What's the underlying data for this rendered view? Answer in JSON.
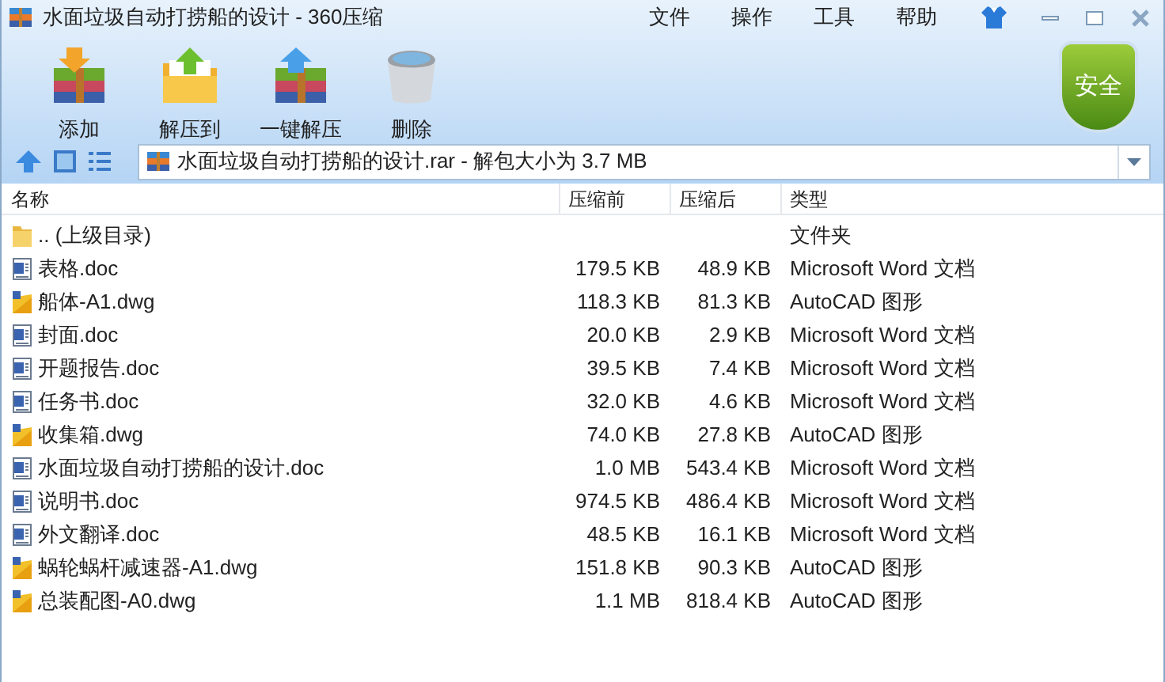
{
  "window": {
    "title": "水面垃圾自动打捞船的设计 - 360压缩"
  },
  "menu": [
    "文件",
    "操作",
    "工具",
    "帮助"
  ],
  "toolbar": [
    {
      "kind": "add",
      "label": "添加"
    },
    {
      "kind": "extract_to",
      "label": "解压到"
    },
    {
      "kind": "extract",
      "label": "一键解压"
    },
    {
      "kind": "delete",
      "label": "删除"
    }
  ],
  "security_badge": "安全",
  "address": "水面垃圾自动打捞船的设计.rar - 解包大小为 3.7 MB",
  "table": {
    "columns": [
      "名称",
      "压缩前",
      "压缩后",
      "类型"
    ],
    "rows": [
      {
        "kind": "folder",
        "name": ".. (上级目录)",
        "type": "文件夹"
      },
      {
        "kind": "doc",
        "name": "表格.doc",
        "before": "179.5 KB",
        "after": "48.9 KB",
        "type": "Microsoft Word 文档"
      },
      {
        "kind": "dwg",
        "name": "船体-A1.dwg",
        "before": "118.3 KB",
        "after": "81.3 KB",
        "type": "AutoCAD 图形"
      },
      {
        "kind": "doc",
        "name": "封面.doc",
        "before": "20.0 KB",
        "after": "2.9 KB",
        "type": "Microsoft Word 文档"
      },
      {
        "kind": "doc",
        "name": "开题报告.doc",
        "before": "39.5 KB",
        "after": "7.4 KB",
        "type": "Microsoft Word 文档"
      },
      {
        "kind": "doc",
        "name": "任务书.doc",
        "before": "32.0 KB",
        "after": "4.6 KB",
        "type": "Microsoft Word 文档"
      },
      {
        "kind": "dwg",
        "name": "收集箱.dwg",
        "before": "74.0 KB",
        "after": "27.8 KB",
        "type": "AutoCAD 图形"
      },
      {
        "kind": "doc",
        "name": "水面垃圾自动打捞船的设计.doc",
        "before": "1.0 MB",
        "after": "543.4 KB",
        "type": "Microsoft Word 文档"
      },
      {
        "kind": "doc",
        "name": "说明书.doc",
        "before": "974.5 KB",
        "after": "486.4 KB",
        "type": "Microsoft Word 文档"
      },
      {
        "kind": "doc",
        "name": "外文翻译.doc",
        "before": "48.5 KB",
        "after": "16.1 KB",
        "type": "Microsoft Word 文档"
      },
      {
        "kind": "dwg",
        "name": "蜗轮蜗杆减速器-A1.dwg",
        "before": "151.8 KB",
        "after": "90.3 KB",
        "type": "AutoCAD 图形"
      },
      {
        "kind": "dwg",
        "name": "总装配图-A0.dwg",
        "before": "1.1 MB",
        "after": "818.4 KB",
        "type": "AutoCAD 图形"
      }
    ]
  }
}
